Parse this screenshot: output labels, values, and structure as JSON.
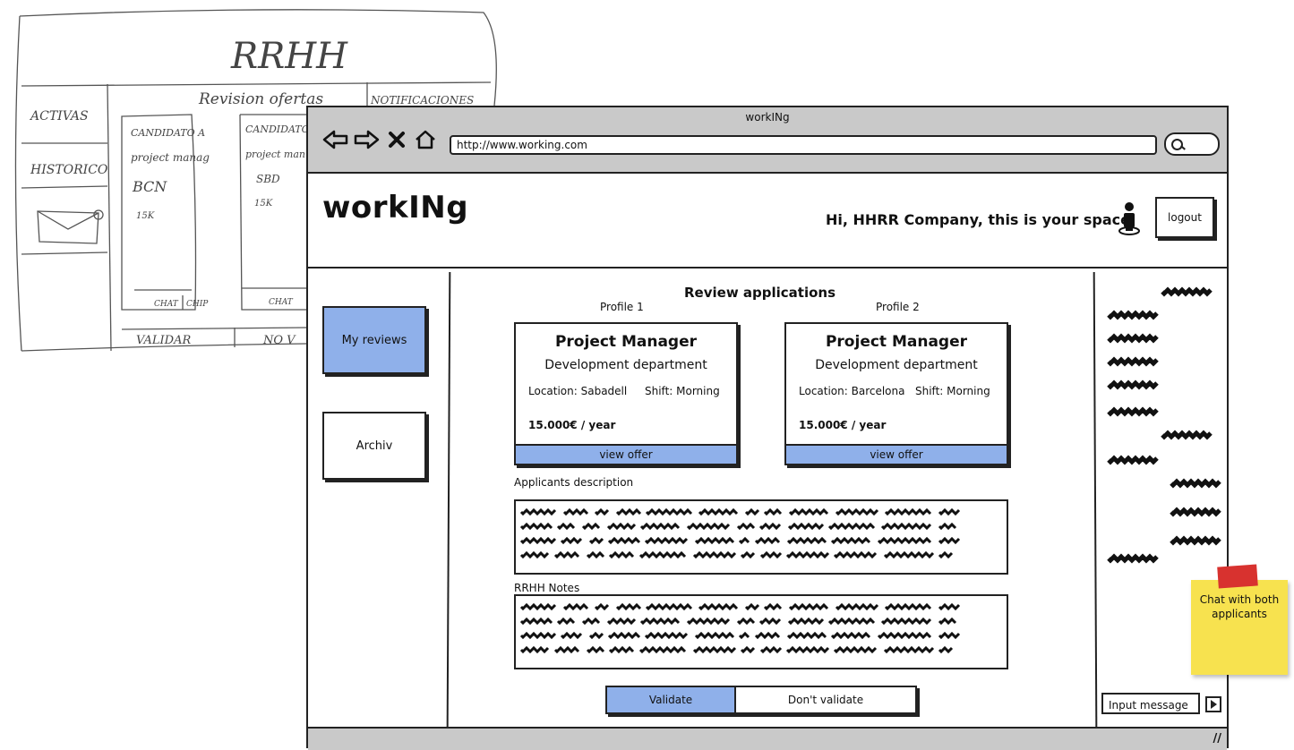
{
  "sketch": {
    "title": "RRHH",
    "tab_review": "Revision ofertas",
    "tab_other": "NOTIFICACIONES",
    "side_active": "ACTIVAS",
    "side_history": "HISTORICO",
    "candidate_a": {
      "heading": "CANDIDATO A",
      "role": "project manag",
      "city": "BCN",
      "salary": "15K"
    },
    "candidate_b": {
      "heading": "CANDIDATO",
      "role": "project man",
      "city": "SBD",
      "salary": "15K"
    },
    "chat_a": "CHAT",
    "chip_a": "CHIP",
    "chat_b": "CHAT",
    "validate": "VALIDAR",
    "no_validate": "NO V"
  },
  "browser": {
    "window_title": "workINg",
    "url": "http://www.working.com"
  },
  "app": {
    "brand": "workINg",
    "greeting": "Hi, HHRR Company, this is your space",
    "logout_label": "logout"
  },
  "sidebar": {
    "items": [
      {
        "label": "My reviews",
        "selected": true
      },
      {
        "label": "Archiv",
        "selected": false
      }
    ]
  },
  "main": {
    "title": "Review applications",
    "profiles": [
      {
        "label": "Profile 1",
        "job": "Project Manager",
        "department": "Development department",
        "location": "Location: Sabadell",
        "shift": "Shift: Morning",
        "salary": "15.000€ / year",
        "action": "view offer"
      },
      {
        "label": "Profile 2",
        "job": "Project Manager",
        "department": "Development department",
        "location": "Location: Barcelona",
        "shift": "Shift: Morning",
        "salary": "15.000€ / year",
        "action": "view offer"
      }
    ],
    "applicants_label": "Applicants description",
    "notes_label": "RRHH Notes",
    "validate_label": "Validate",
    "no_validate_label": "Don't validate"
  },
  "chat": {
    "input_placeholder": "Input message"
  },
  "sticky_note": {
    "text": "Chat with both applicants"
  },
  "colors": {
    "accent": "#8fb0ea",
    "chrome": "#c9c9c9",
    "sticky": "#f7e24f",
    "tape": "#d8322f"
  }
}
